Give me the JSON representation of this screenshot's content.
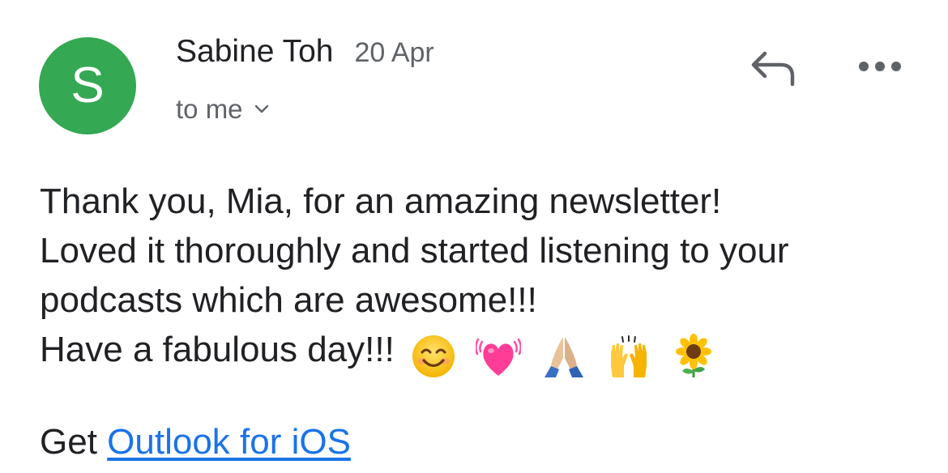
{
  "header": {
    "avatar_letter": "S",
    "sender_name": "Sabine Toh",
    "date": "20 Apr",
    "recipient": "to me",
    "icons": [
      "chevron-down-icon",
      "reply-icon",
      "more-options-icon"
    ]
  },
  "message": {
    "lines": [
      "Thank you, Mia, for an amazing newsletter!",
      "Loved it thoroughly and started listening to your",
      "podcasts which are awesome!!!",
      "Have a fabulous day!!!"
    ],
    "emojis": [
      "smiling-face-emoji",
      "beating-heart-emoji",
      "folded-hands-emoji",
      "raising-hands-emoji",
      "sunflower-emoji"
    ]
  },
  "signature": {
    "prefix": "Get",
    "link_text": "Outlook for iOS"
  },
  "colors": {
    "avatar": "#34a853",
    "link": "#1a73e8",
    "secondary_text": "#5f6368"
  }
}
